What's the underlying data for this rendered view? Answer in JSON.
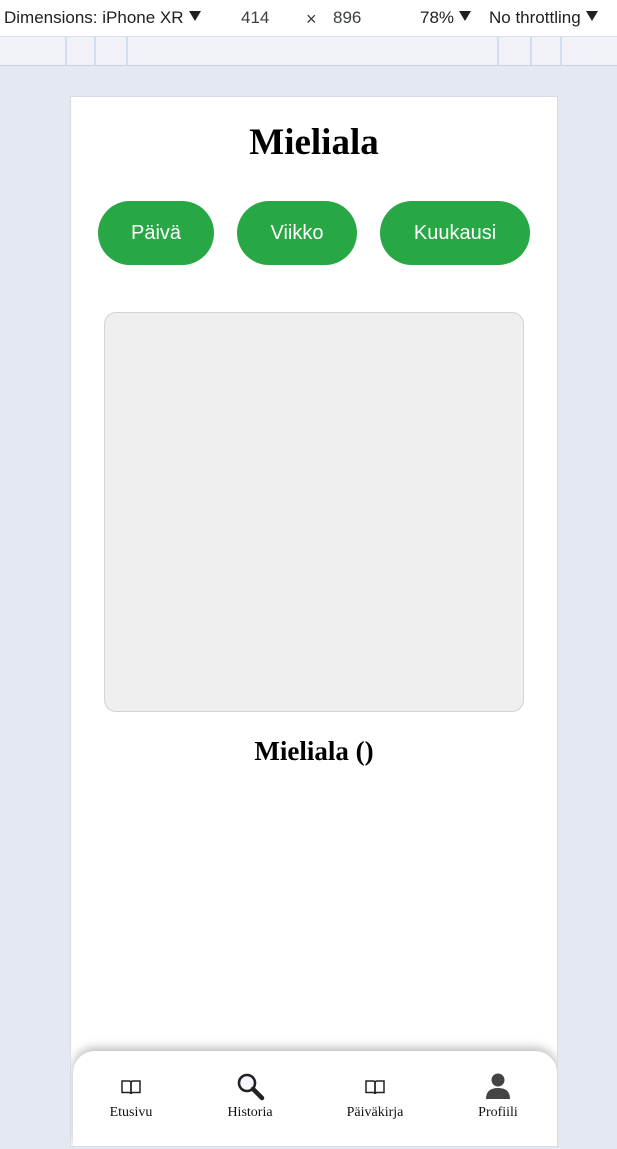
{
  "devtools": {
    "device_label": "Dimensions: iPhone XR",
    "width": "414",
    "times": "×",
    "height": "896",
    "zoom": "78%",
    "throttling": "No throttling"
  },
  "page": {
    "title": "Mieliala",
    "period_buttons": [
      "Päivä",
      "Viikko",
      "Kuukausi"
    ],
    "chart_caption": "Mieliala ()",
    "accent_color": "#28a745"
  },
  "nav": {
    "items": [
      {
        "label": "Etusivu",
        "icon": "book-icon"
      },
      {
        "label": "Historia",
        "icon": "search-icon"
      },
      {
        "label": "Päiväkirja",
        "icon": "book-icon"
      },
      {
        "label": "Profiili",
        "icon": "person-icon"
      }
    ]
  }
}
